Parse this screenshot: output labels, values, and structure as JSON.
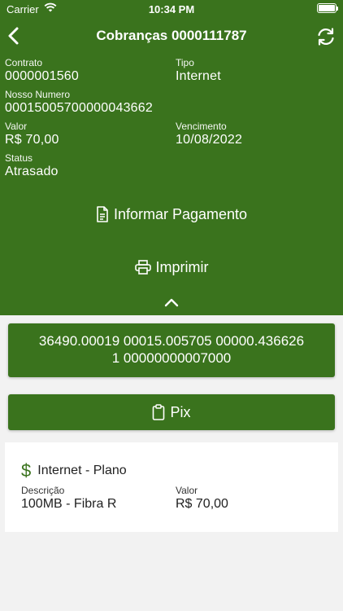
{
  "status_bar": {
    "carrier": "Carrier",
    "time": "10:34 PM"
  },
  "nav": {
    "title": "Cobranças 0000111787"
  },
  "details": {
    "contrato": {
      "label": "Contrato",
      "value": "0000001560"
    },
    "tipo": {
      "label": "Tipo",
      "value": "Internet"
    },
    "nosso_numero": {
      "label": "Nosso Numero",
      "value": "00015005700000043662"
    },
    "valor": {
      "label": "Valor",
      "value": "R$ 70,00"
    },
    "vencimento": {
      "label": "Vencimento",
      "value": "10/08/2022"
    },
    "status": {
      "label": "Status",
      "value": "Atrasado"
    }
  },
  "actions": {
    "informar_pagamento": "Informar Pagamento",
    "imprimir": "Imprimir",
    "pix": "Pix"
  },
  "barcode": {
    "line1": "36490.00019 00015.005705 00000.436626",
    "line2": "1 00000000007000"
  },
  "item": {
    "title": "Internet - Plano",
    "icon": "dollar-icon",
    "descricao": {
      "label": "Descrição",
      "value": "100MB - Fibra R"
    },
    "valor": {
      "label": "Valor",
      "value": "R$ 70,00"
    }
  },
  "colors": {
    "primary": "#3a731d",
    "background": "#f2f2f2",
    "card": "#ffffff"
  }
}
